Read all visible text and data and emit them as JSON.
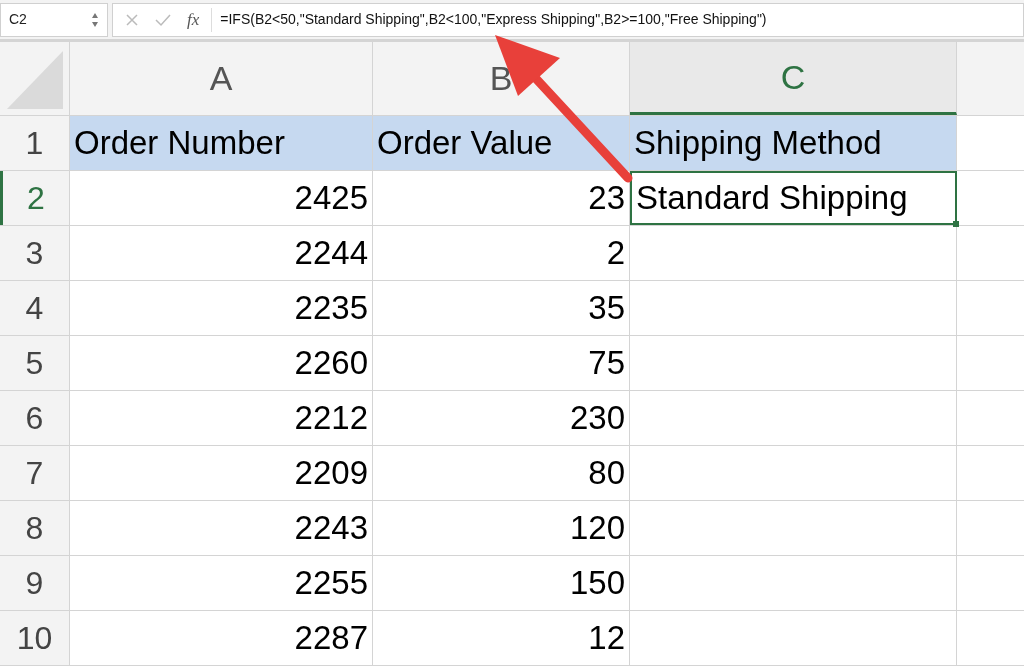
{
  "name_box": "C2",
  "function_label": "fx",
  "formula": "=IFS(B2<50,\"Standard Shipping\",B2<100,\"Express Shipping\",B2>=100,\"Free Shipping\")",
  "columns": [
    {
      "label": "A",
      "selected": false
    },
    {
      "label": "B",
      "selected": false
    },
    {
      "label": "C",
      "selected": true
    }
  ],
  "rows": [
    {
      "number": "1",
      "kind": "header",
      "selected": false,
      "cells": [
        {
          "text": "Order Number",
          "kind": "text",
          "selected": false
        },
        {
          "text": "Order Value",
          "kind": "text",
          "selected": false
        },
        {
          "text": "Shipping Method",
          "kind": "text",
          "selected": false
        }
      ]
    },
    {
      "number": "2",
      "kind": "data",
      "selected": true,
      "cells": [
        {
          "text": "2425",
          "kind": "number",
          "selected": false
        },
        {
          "text": "23",
          "kind": "number",
          "selected": false
        },
        {
          "text": "Standard Shipping",
          "kind": "text",
          "selected": true
        }
      ]
    },
    {
      "number": "3",
      "kind": "data",
      "selected": false,
      "cells": [
        {
          "text": "2244",
          "kind": "number",
          "selected": false
        },
        {
          "text": "2",
          "kind": "number",
          "selected": false
        }
      ]
    },
    {
      "number": "4",
      "kind": "data",
      "selected": false,
      "cells": [
        {
          "text": "2235",
          "kind": "number",
          "selected": false
        },
        {
          "text": "35",
          "kind": "number",
          "selected": false
        }
      ]
    },
    {
      "number": "5",
      "kind": "data",
      "selected": false,
      "cells": [
        {
          "text": "2260",
          "kind": "number",
          "selected": false
        },
        {
          "text": "75",
          "kind": "number",
          "selected": false
        }
      ]
    },
    {
      "number": "6",
      "kind": "data",
      "selected": false,
      "cells": [
        {
          "text": "2212",
          "kind": "number",
          "selected": false
        },
        {
          "text": "230",
          "kind": "number",
          "selected": false
        }
      ]
    },
    {
      "number": "7",
      "kind": "data",
      "selected": false,
      "cells": [
        {
          "text": "2209",
          "kind": "number",
          "selected": false
        },
        {
          "text": "80",
          "kind": "number",
          "selected": false
        }
      ]
    },
    {
      "number": "8",
      "kind": "data",
      "selected": false,
      "cells": [
        {
          "text": "2243",
          "kind": "number",
          "selected": false
        },
        {
          "text": "120",
          "kind": "number",
          "selected": false
        }
      ]
    },
    {
      "number": "9",
      "kind": "data",
      "selected": false,
      "cells": [
        {
          "text": "2255",
          "kind": "number",
          "selected": false
        },
        {
          "text": "150",
          "kind": "number",
          "selected": false
        }
      ]
    },
    {
      "number": "10",
      "kind": "data",
      "selected": false,
      "cells": [
        {
          "text": "2287",
          "kind": "number",
          "selected": false
        },
        {
          "text": "12",
          "kind": "number",
          "selected": false
        }
      ]
    }
  ]
}
